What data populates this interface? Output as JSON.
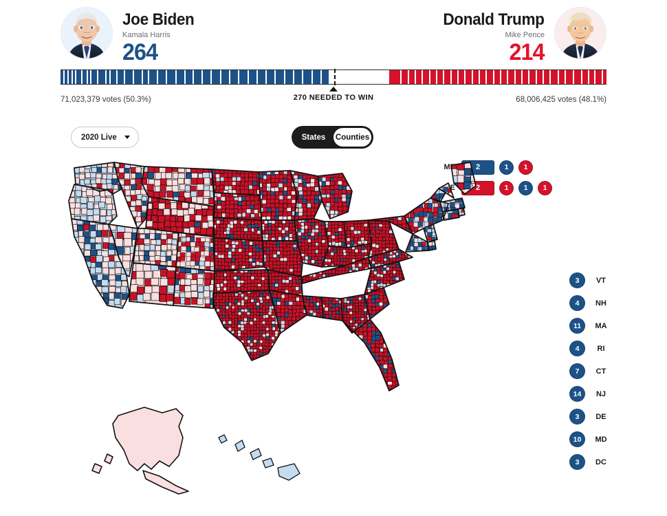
{
  "header": {
    "left_candidate": {
      "name": "Joe Biden",
      "running_mate": "Kamala Harris",
      "electoral_votes": "264",
      "popular_votes": "71,023,379 votes (50.3%)",
      "color": "#1d5288",
      "avatar_name": "joe-biden-photo"
    },
    "right_candidate": {
      "name": "Donald Trump",
      "running_mate": "Mike Pence",
      "electoral_votes": "214",
      "popular_votes": "68,006,425 votes (48.1%)",
      "color": "#d4132b",
      "avatar_name": "donald-trump-photo"
    },
    "threshold_label": "270 NEEDED TO WIN",
    "threshold_value": 270,
    "total_electoral": 538
  },
  "controls": {
    "year_dropdown": {
      "selected": "2020 Live",
      "icon": "chevron-down-icon"
    },
    "view_toggle": {
      "options": [
        "States",
        "Counties"
      ],
      "selected": "Counties"
    }
  },
  "districts": [
    {
      "state": "ME",
      "at_large": {
        "value": "2",
        "party": "dem"
      },
      "seats": [
        {
          "value": "1",
          "party": "dem"
        },
        {
          "value": "1",
          "party": "rep"
        }
      ]
    },
    {
      "state": "NE",
      "at_large": {
        "value": "2",
        "party": "rep"
      },
      "seats": [
        {
          "value": "1",
          "party": "rep"
        },
        {
          "value": "1",
          "party": "dem"
        },
        {
          "value": "1",
          "party": "rep"
        }
      ]
    }
  ],
  "small_states": [
    {
      "abbr": "VT",
      "votes": "3",
      "party": "dem"
    },
    {
      "abbr": "NH",
      "votes": "4",
      "party": "dem"
    },
    {
      "abbr": "MA",
      "votes": "11",
      "party": "dem"
    },
    {
      "abbr": "RI",
      "votes": "4",
      "party": "dem"
    },
    {
      "abbr": "CT",
      "votes": "7",
      "party": "dem"
    },
    {
      "abbr": "NJ",
      "votes": "14",
      "party": "dem"
    },
    {
      "abbr": "DE",
      "votes": "3",
      "party": "dem"
    },
    {
      "abbr": "MD",
      "votes": "10",
      "party": "dem"
    },
    {
      "abbr": "DC",
      "votes": "3",
      "party": "dem"
    }
  ],
  "palette": {
    "dem_strong": "#1d5288",
    "dem_light": "#c5dcf0",
    "rep_strong": "#cc1127",
    "rep_light": "#fadfe0",
    "bar_dem": "#1d5288",
    "bar_rep": "#d4132b",
    "border": "#111111"
  },
  "map": {
    "title": "2020 presidential election county results map",
    "projection": "albers-usa"
  }
}
